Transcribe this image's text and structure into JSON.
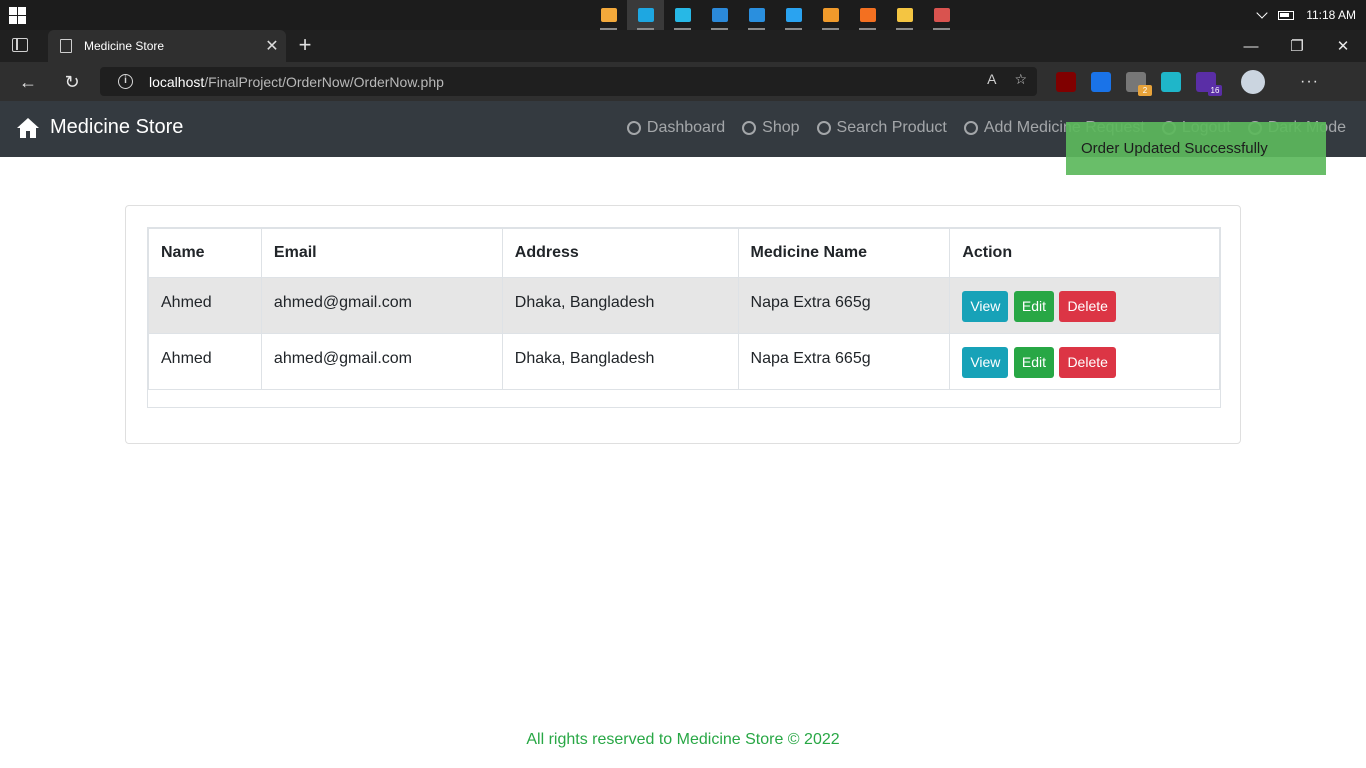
{
  "taskbar": {
    "apps": [
      {
        "name": "virtualbox-icon",
        "color": "#f3a93b",
        "active": false
      },
      {
        "name": "edge-icon",
        "color": "#1ea7e1",
        "active": true
      },
      {
        "name": "remote-app-icon",
        "color": "#27b8e6",
        "active": false
      },
      {
        "name": "monitor-app-icon",
        "color": "#2b89d9",
        "active": false
      },
      {
        "name": "bluetooth-app-icon",
        "color": "#2a8fde",
        "active": false
      },
      {
        "name": "vscode-icon",
        "color": "#2aa3f0",
        "active": false
      },
      {
        "name": "sublime-text-icon",
        "color": "#f09a2b",
        "active": false
      },
      {
        "name": "xampp-icon",
        "color": "#f37021",
        "active": false
      },
      {
        "name": "file-explorer-icon",
        "color": "#f4c542",
        "active": false
      },
      {
        "name": "paint-app-icon",
        "color": "#d9534f",
        "active": false
      }
    ],
    "clock": "11:18 AM"
  },
  "browser": {
    "tab_title": "Medicine Store",
    "tab_close": "✕",
    "new_tab": "+",
    "minimize": "—",
    "restore": "❐",
    "close": "✕",
    "back": "←",
    "reload": "↻",
    "url_host": "localhost",
    "url_path": "/FinalProject/OrderNow/OrderNow.php",
    "read_aloud": "A",
    "favorites": "☆",
    "extensions": [
      {
        "name": "ublock-icon",
        "color": "#800000",
        "badge": ""
      },
      {
        "name": "s-extension-icon",
        "color": "#1a73e8",
        "badge": ""
      },
      {
        "name": "puzzle-extension-icon",
        "color": "#777777",
        "badge": "2",
        "badge_color": "#e8a33a"
      },
      {
        "name": "share-extension-icon",
        "color": "#1fb6c9",
        "badge": ""
      },
      {
        "name": "hat-extension-icon",
        "color": "#5a2ea6",
        "badge": "16",
        "badge_color": "#5a2ea6"
      }
    ],
    "more": "···"
  },
  "navbar": {
    "brand": "Medicine Store",
    "links": [
      {
        "label": "Dashboard",
        "icon": "dashboard-icon"
      },
      {
        "label": "Shop",
        "icon": "cart-icon"
      },
      {
        "label": "Search Product",
        "icon": "search-icon"
      },
      {
        "label": "Add Medicine Request",
        "icon": "pills-icon"
      },
      {
        "label": "Logout",
        "icon": "logout-icon"
      },
      {
        "label": "Dark Mode",
        "icon": "toggle-icon"
      }
    ]
  },
  "toast": {
    "message": "Order Updated Successfully"
  },
  "table": {
    "headers": [
      "Name",
      "Email",
      "Address",
      "Medicine Name",
      "Action"
    ],
    "rows": [
      {
        "name": "Ahmed",
        "email": "ahmed@gmail.com",
        "address": "Dhaka, Bangladesh",
        "medicine": "Napa Extra 665g"
      },
      {
        "name": "Ahmed",
        "email": "ahmed@gmail.com",
        "address": "Dhaka, Bangladesh",
        "medicine": "Napa Extra 665g"
      }
    ],
    "actions": {
      "view": "View",
      "edit": "Edit",
      "delete": "Delete"
    }
  },
  "colors": {
    "view": "#17a2b8",
    "edit": "#28a745",
    "delete": "#dc3545",
    "navbar": "#343a40",
    "toast": "#5cb85c"
  },
  "footer": {
    "text": "All rights reserved to Medicine Store © 2022"
  }
}
